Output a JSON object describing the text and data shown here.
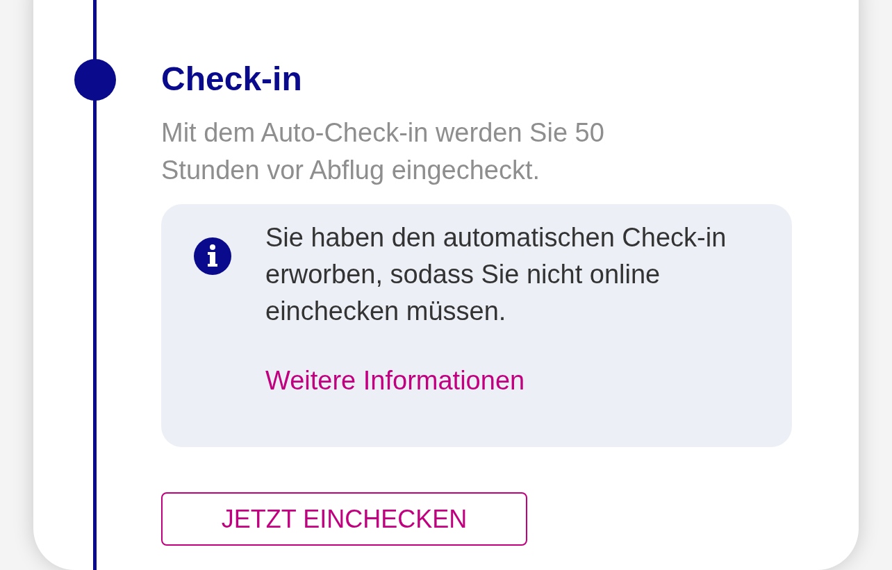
{
  "step": {
    "title": "Check-in",
    "description": "Mit dem Auto-Check-in werden Sie 50 Stunden vor Abflug eingecheckt."
  },
  "notice": {
    "text": "Sie haben den automatischen Check-in erworben, sodass Sie nicht online einchecken müssen.",
    "link": "Weitere Informationen"
  },
  "button": {
    "label": "JETZT EINCHECKEN"
  }
}
